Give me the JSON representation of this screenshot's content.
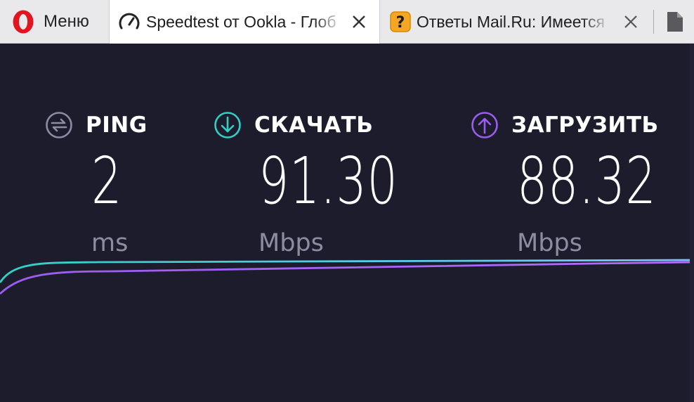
{
  "browser": {
    "menu_label": "Меню",
    "tabs": [
      {
        "title": "Speedtest от Ookla - Глоб",
        "icon": "speedometer-icon",
        "active": true
      },
      {
        "title": "Ответы Mail.Ru: Имеется",
        "icon": "question-icon",
        "active": false
      },
      {
        "title": "",
        "icon": "document-icon",
        "active": false
      }
    ]
  },
  "speedtest": {
    "ping": {
      "label": "PING",
      "value": "2",
      "unit": "ms",
      "icon": "ping-icon",
      "color": "#8d8da1"
    },
    "download": {
      "label": "СКАЧАТЬ",
      "value": "91.30",
      "unit": "Mbps",
      "icon": "download-arrow-icon",
      "color": "#2fd1c6"
    },
    "upload": {
      "label": "ЗАГРУЗИТЬ",
      "value": "88.32",
      "unit": "Mbps",
      "icon": "upload-arrow-icon",
      "color": "#9b5cf0"
    }
  }
}
